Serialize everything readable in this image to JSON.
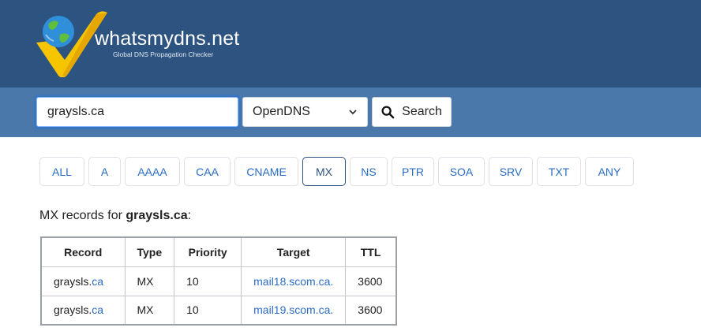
{
  "brand": {
    "name": "whatsmydns.net",
    "tagline": "Global DNS Propagation Checker"
  },
  "search": {
    "value": "graysls.ca",
    "server": "OpenDNS",
    "button_label": "Search"
  },
  "record_types": [
    {
      "label": "ALL"
    },
    {
      "label": "A"
    },
    {
      "label": "AAAA"
    },
    {
      "label": "CAA"
    },
    {
      "label": "CNAME"
    },
    {
      "label": "MX",
      "active": true
    },
    {
      "label": "NS"
    },
    {
      "label": "PTR"
    },
    {
      "label": "SOA"
    },
    {
      "label": "SRV"
    },
    {
      "label": "TXT"
    },
    {
      "label": "ANY"
    }
  ],
  "results": {
    "prefix": "MX records for ",
    "domain": "graysls.ca",
    "suffix": ":",
    "columns": [
      "Record",
      "Type",
      "Priority",
      "Target",
      "TTL"
    ],
    "rows": [
      {
        "record_name": "graysls.",
        "record_tld": "ca",
        "type": "MX",
        "priority": "10",
        "target": "mail18.scom.ca.",
        "ttl": "3600"
      },
      {
        "record_name": "graysls.",
        "record_tld": "ca",
        "type": "MX",
        "priority": "10",
        "target": "mail19.scom.ca.",
        "ttl": "3600"
      }
    ]
  },
  "colors": {
    "header": "#2d5380",
    "searchbar": "#4a78aa",
    "link": "#2b6cc4",
    "logo_yellow": "#f7c500"
  }
}
